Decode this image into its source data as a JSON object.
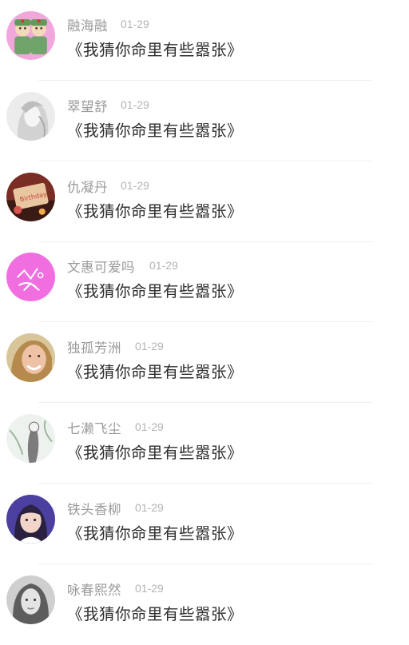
{
  "comments": [
    {
      "user": "融海融",
      "date": "01-29",
      "text": "《我猜你命里有些嚣张》",
      "avatar": "avatar-cartoon-soldiers-icon",
      "avatar_colors": [
        "#ee9ed8",
        "#6fa36a"
      ]
    },
    {
      "user": "翠望舒",
      "date": "01-29",
      "text": "《我猜你命里有些嚣张》",
      "avatar": "avatar-sketch-portrait-icon",
      "avatar_colors": [
        "#e6e6e6",
        "#b8b8b8"
      ]
    },
    {
      "user": "仇凝丹",
      "date": "01-29",
      "text": "《我猜你命里有些嚣张》",
      "avatar": "avatar-birthday-cake-icon",
      "avatar_colors": [
        "#c9473c",
        "#e8c7a0"
      ]
    },
    {
      "user": "文惠可爱吗",
      "date": "01-29",
      "text": "《我猜你命里有些嚣张》",
      "avatar": "avatar-pink-doodle-icon",
      "avatar_colors": [
        "#f06ee0",
        "#ffffff"
      ]
    },
    {
      "user": "独孤芳洲",
      "date": "01-29",
      "text": "《我猜你命里有些嚣张》",
      "avatar": "avatar-smiling-woman-icon",
      "avatar_colors": [
        "#c9b07a",
        "#e6b59a"
      ]
    },
    {
      "user": "七濑飞尘",
      "date": "01-29",
      "text": "《我猜你命里有些嚣张》",
      "avatar": "avatar-ink-painting-icon",
      "avatar_colors": [
        "#e9efe9",
        "#6a6a6a"
      ]
    },
    {
      "user": "铁头香柳",
      "date": "01-29",
      "text": "《我猜你命里有些嚣张》",
      "avatar": "avatar-anime-girl-icon",
      "avatar_colors": [
        "#4b3fa0",
        "#f2d4c8"
      ]
    },
    {
      "user": "咏春熙然",
      "date": "01-29",
      "text": "《我猜你命里有些嚣张》",
      "avatar": "avatar-grayscale-portrait-icon",
      "avatar_colors": [
        "#d0d0d0",
        "#5a5a5a"
      ]
    }
  ]
}
